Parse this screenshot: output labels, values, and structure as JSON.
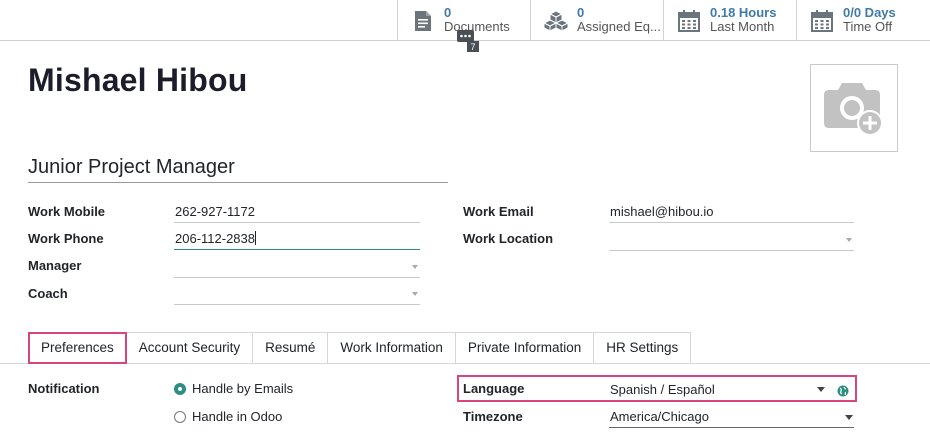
{
  "smart_buttons": {
    "documents": {
      "value": "0",
      "label": "Documents",
      "icon": "file-icon"
    },
    "equipment": {
      "value": "0",
      "label": "Assigned Eq...",
      "icon": "cubes-icon"
    },
    "hours": {
      "value": "0.18 Hours",
      "label": "Last Month",
      "icon": "calendar-icon"
    },
    "timeoff": {
      "value": "0/0 Days",
      "label": "Time Off",
      "icon": "calendar-icon"
    }
  },
  "chat_badge": "7",
  "employee": {
    "name": "Mishael Hibou",
    "job_title": "Junior Project Manager"
  },
  "fields": {
    "work_mobile": {
      "label": "Work Mobile",
      "value": "262-927-1172"
    },
    "work_phone": {
      "label": "Work Phone",
      "value": "206-112-2838"
    },
    "manager": {
      "label": "Manager",
      "value": ""
    },
    "coach": {
      "label": "Coach",
      "value": ""
    },
    "work_email": {
      "label": "Work Email",
      "value": "mishael@hibou.io"
    },
    "work_location": {
      "label": "Work Location",
      "value": ""
    }
  },
  "tabs": [
    "Preferences",
    "Account Security",
    "Resumé",
    "Work Information",
    "Private Information",
    "HR Settings"
  ],
  "preferences": {
    "notification_label": "Notification",
    "options": [
      "Handle by Emails",
      "Handle in Odoo"
    ],
    "language_label": "Language",
    "language_value": "Spanish / Español",
    "timezone_label": "Timezone",
    "timezone_value": "America/Chicago"
  },
  "colors": {
    "accent_teal": "#2c8d82",
    "highlight_pink": "#d6457b",
    "smart_value_blue": "#3f7ba6"
  }
}
